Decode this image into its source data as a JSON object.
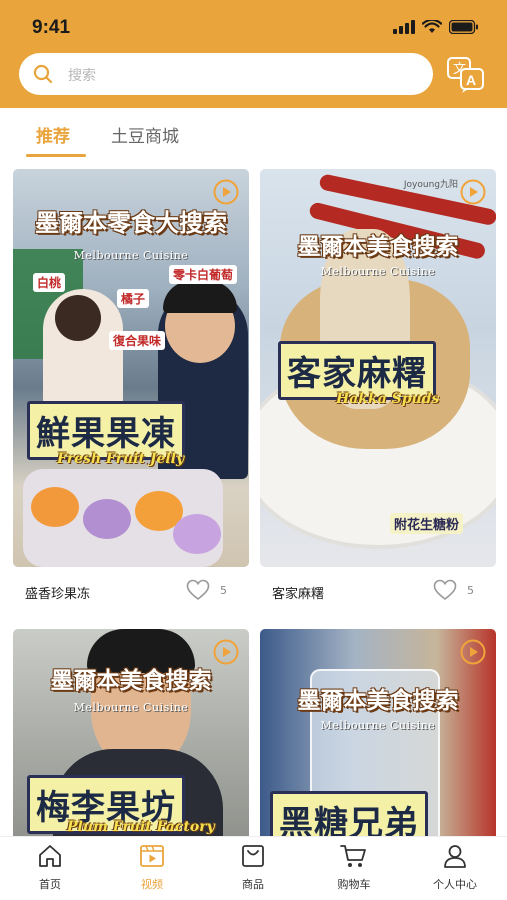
{
  "status_bar": {
    "time": "9:41"
  },
  "search": {
    "placeholder": "搜索"
  },
  "tabs": [
    {
      "label": "推荐",
      "active": true
    },
    {
      "label": "土豆商城",
      "active": false
    }
  ],
  "feed": [
    {
      "caption": "盛香珍果冻",
      "likes": "5",
      "thumb_title": "墨爾本零食大搜索",
      "thumb_subtitle": "Melbourne Cuisine",
      "tags": [
        "白桃",
        "橘子",
        "零卡白葡萄",
        "復合果味"
      ],
      "big_label": "鮮果果凍",
      "en_label": "Fresh Fruit Jelly"
    },
    {
      "caption": "客家麻糬",
      "likes": "5",
      "thumb_title": "墨爾本美食搜索",
      "thumb_subtitle": "Melbourne Cuisine",
      "big_label": "客家麻糬",
      "en_label": "Hakka Spuds",
      "footnote": "附花生糖粉",
      "brand_mark": "Joyoung九阳"
    },
    {
      "thumb_title": "墨爾本美食搜索",
      "thumb_subtitle": "Melbourne Cuisine",
      "big_label": "梅李果坊",
      "en_label": "Plum Fruit Factory"
    },
    {
      "thumb_title": "墨爾本美食搜索",
      "thumb_subtitle": "Melbourne Cuisine",
      "big_label": "黑糖兄弟"
    }
  ],
  "bottom_nav": [
    {
      "label": "首页",
      "icon": "home-icon",
      "active": false
    },
    {
      "label": "视频",
      "icon": "video-icon",
      "active": true
    },
    {
      "label": "商品",
      "icon": "shopping-bag-icon",
      "active": false
    },
    {
      "label": "购物车",
      "icon": "cart-icon",
      "active": false
    },
    {
      "label": "个人中心",
      "icon": "user-icon",
      "active": false
    }
  ],
  "colors": {
    "accent": "#e9a43c",
    "header_bg": "#e9a43c",
    "placeholder": "#b8b8b8",
    "icon_gray": "#999999"
  }
}
